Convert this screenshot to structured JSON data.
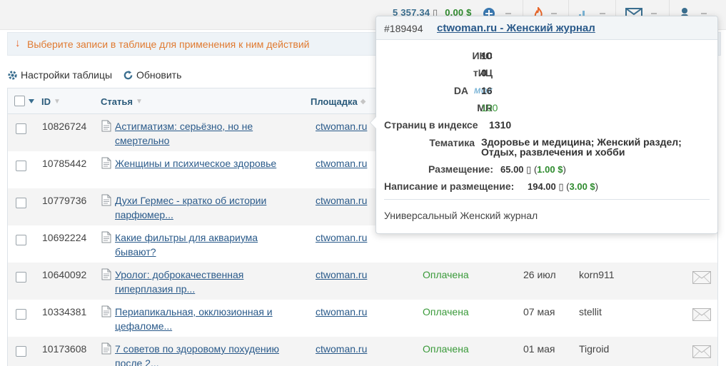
{
  "header": {
    "balance_rub": "5 357.34",
    "balance_usd": "0.00 $"
  },
  "notice": {
    "text": "Выберите записи в таблице для применения к ним действий"
  },
  "toolbar": {
    "settings_label": "Настройки таблицы",
    "refresh_label": "Обновить"
  },
  "table": {
    "columns": {
      "id": "ID",
      "article": "Статья",
      "site": "Площадка"
    },
    "rows": [
      {
        "id": "10826724",
        "title": "Астигматизм: серьёзно, но не смертельно",
        "site": "ctwoman.ru",
        "status": "",
        "date": "",
        "user": ""
      },
      {
        "id": "10785442",
        "title": "Женщины и психическое здоровье",
        "site": "ctwoman.ru",
        "status": "",
        "date": "",
        "user": ""
      },
      {
        "id": "10779736",
        "title": "Духи Гермес - кратко об истории парфюмер...",
        "site": "ctwoman.ru",
        "status": "",
        "date": "",
        "user": ""
      },
      {
        "id": "10692224",
        "title": "Какие фильтры для аквариума бывают?",
        "site": "ctwoman.ru",
        "status": "",
        "date": "",
        "user": ""
      },
      {
        "id": "10640092",
        "title": "Уролог: доброкачественная гиперплазия пр...",
        "site": "ctwoman.ru",
        "status": "Оплачена",
        "date": "26 июл",
        "user": "korn911"
      },
      {
        "id": "10334381",
        "title": "Периапикальная, окклюзионная и цефаломе...",
        "site": "ctwoman.ru",
        "status": "Оплачена",
        "date": "07 мая",
        "user": "stellit"
      },
      {
        "id": "10173608",
        "title": "7 советов по здоровому похудению после 2...",
        "site": "ctwoman.ru",
        "status": "Оплачена",
        "date": "01 мая",
        "user": "Tigroid"
      }
    ]
  },
  "popover": {
    "number": "#189494",
    "title": "ctwoman.ru - Женский журнал",
    "iks_label": "ИКС",
    "iks_value": "10",
    "tic_label": "тИЦ",
    "tic_value": "0",
    "da_label": "DA",
    "moz_label": "MOZ",
    "da_value": "16",
    "mr_label": "MR",
    "mr_value": "100",
    "pages_label": "Страниц в индексе",
    "pages_value": "1310",
    "topic_label": "Тематика",
    "topic_value": "Здоровье и медицина; Женский раздел; Отдых, развлечения и хобби",
    "placement_label": "Размещение:",
    "placement_rub": "65.00",
    "placement_usd": "1.00 $",
    "writing_label": "Написание и размещение:",
    "writing_rub": "194.00",
    "writing_usd": "3.00 $",
    "description": "Универсальный Женский журнал"
  },
  "colors": {
    "link": "#2a5a8a",
    "paid_status": "#3a9a3a",
    "notice_text": "#e07a30",
    "usd": "#2e8b2e"
  }
}
